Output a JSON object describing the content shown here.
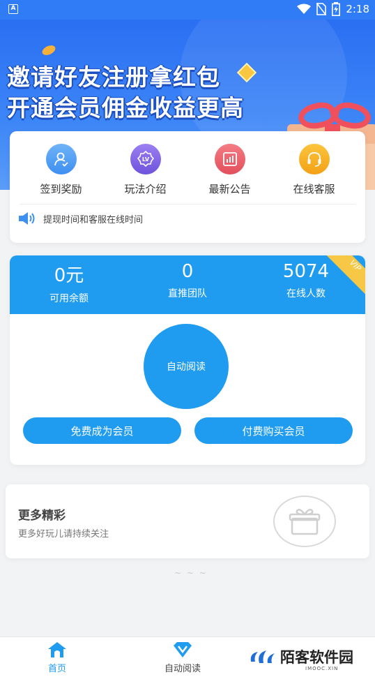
{
  "status_bar": {
    "time": "2:18",
    "app_badge": "A"
  },
  "banner": {
    "line1": "邀请好友注册拿红包",
    "line2": "开通会员佣金收益更高"
  },
  "menu": {
    "items": [
      {
        "label": "签到奖励",
        "icon": "user-checkin-icon",
        "color": "#3d8ff0"
      },
      {
        "label": "玩法介绍",
        "icon": "lv-badge-icon",
        "color": "#6e53dc",
        "badge_text": "LV"
      },
      {
        "label": "最新公告",
        "icon": "chart-notice-icon",
        "color": "#e2505c"
      },
      {
        "label": "在线客服",
        "icon": "headset-icon",
        "color": "#f3a116"
      }
    ],
    "notice": "提现时间和客服在线时间"
  },
  "stats": {
    "items": [
      {
        "value": "0元",
        "label": "可用余额"
      },
      {
        "value": "0",
        "label": "直推团队"
      },
      {
        "value": "5074",
        "label": "在线人数"
      }
    ],
    "vip_tag": "VIP",
    "auto_read_label": "自动阅读",
    "free_member_label": "免费成为会员",
    "paid_member_label": "付费购买会员",
    "accent": "#1f9cf0"
  },
  "more": {
    "title": "更多精彩",
    "subtitle": "更多好玩儿请持续关注"
  },
  "bottom_nav": {
    "items": [
      {
        "label": "首页",
        "icon": "home-icon",
        "active": true
      },
      {
        "label": "自动阅读",
        "icon": "diamond-v-icon",
        "active": false
      }
    ]
  },
  "watermark": {
    "text": "陌客软件园",
    "sub": "IMOOC.XIN"
  }
}
